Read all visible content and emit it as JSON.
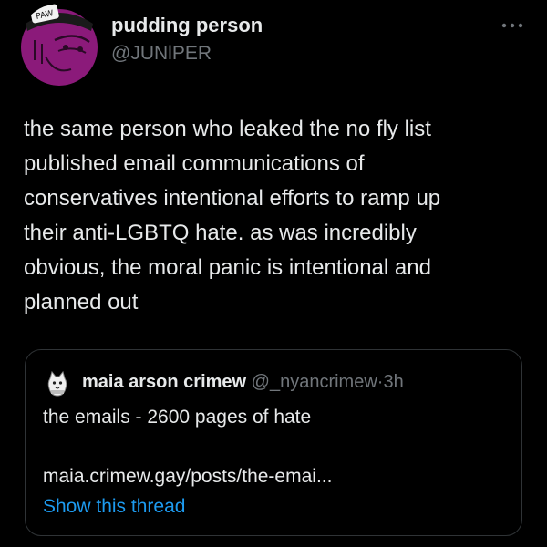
{
  "author": {
    "display_name": "pudding person",
    "handle": "@JUNlPER",
    "avatar_icon": "purple-character-avatar",
    "avatar_badge_text": "PAW"
  },
  "more_icon": "more-horizontal-icon",
  "tweet": {
    "text": "the same person who leaked the no fly list\npublished email communications of\nconservatives intentional efforts to ramp up\ntheir anti-LGBTQ hate.  as was incredibly\nobvious, the moral panic is intentional and\nplanned out"
  },
  "quoted_tweet": {
    "display_name": "maia arson crimew",
    "handle": "@_nyancrimew",
    "separator": "·",
    "time": "3h",
    "avatar_icon": "cat-avatar-icon",
    "text": "the emails - 2600 pages of hate",
    "link": "maia.crimew.gay/posts/the-emai...",
    "show_thread_label": "Show this thread"
  },
  "colors": {
    "background": "#000000",
    "primary_text": "#e7e9ea",
    "secondary_text": "#71767b",
    "link_blue": "#1d9bf0",
    "avatar_purple": "#8b1a7a",
    "border": "#2f3336"
  }
}
